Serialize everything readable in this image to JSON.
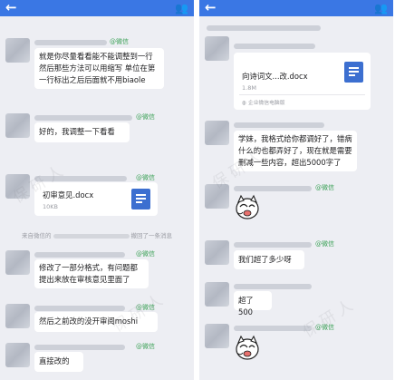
{
  "ui": {
    "back_glyph": "←",
    "people_glyph": "👥",
    "source_tag": "@微信",
    "watermark": "保研人",
    "colors": {
      "topbar": "#3a77e4",
      "tag_green": "#3fa35a",
      "doc_icon": "#3c6fd0",
      "background": "#edeef3"
    }
  },
  "left": {
    "messages": [
      {
        "text": "就是你尽量看看能不能调整到一行 然后那些方法可以用缩写 单位在第一行标出之后后面就不用biaole"
      },
      {
        "text": "好的，我调整一下看看"
      },
      {
        "file_name": "初审意见.docx",
        "file_size": "10KB",
        "icon": "doc-icon"
      },
      {
        "recall_prefix": "来自微信的",
        "recall_suffix": "撤回了一条消息"
      },
      {
        "text": "修改了一部分格式，有问题都提出来放在审核意见里面了"
      },
      {
        "text": "然后之前改的没开审阅moshi"
      },
      {
        "text": "直接改的"
      }
    ]
  },
  "right": {
    "messages": [
      {
        "file_name": "向诗词文...改.docx",
        "file_size": "1.8M",
        "file_source": "企业微信电脑版",
        "icon": "doc-icon"
      },
      {
        "text": "学妹，我格式给你都调好了，错病什么的也都弄好了，现在就是需要删减一些内容，超出5000字了"
      },
      {
        "sticker": "cartoon-cat-sticker"
      },
      {
        "text": "我们超了多少呀"
      },
      {
        "text": "超了500"
      },
      {
        "sticker": "cartoon-cat-sticker"
      }
    ]
  }
}
